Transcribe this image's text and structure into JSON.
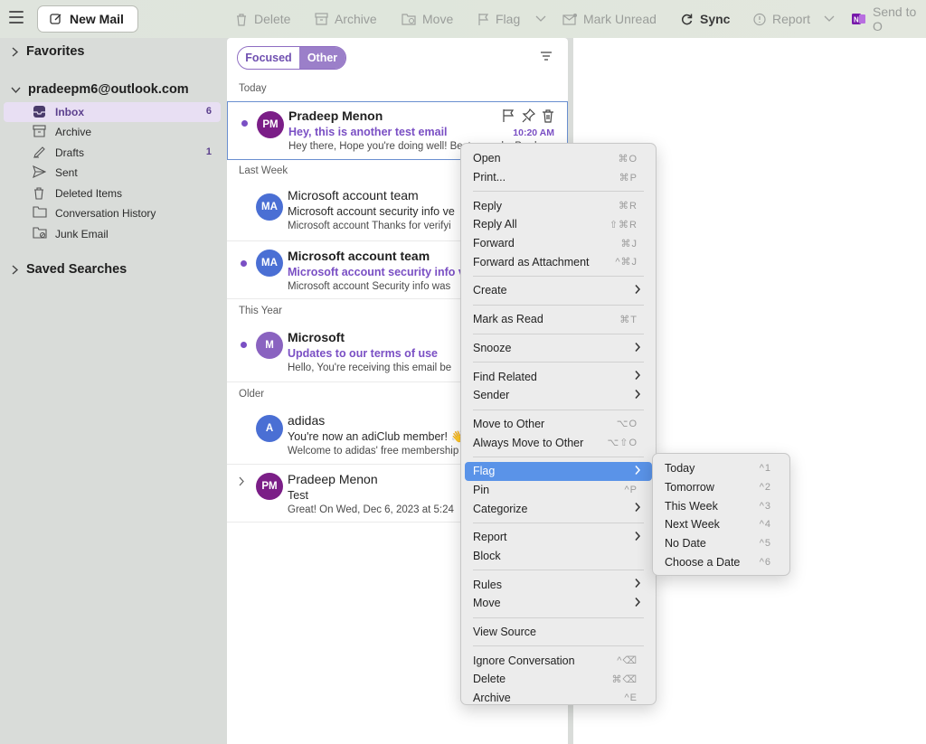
{
  "toolbar": {
    "new_mail": "New Mail",
    "delete": "Delete",
    "archive": "Archive",
    "move": "Move",
    "flag": "Flag",
    "mark_unread": "Mark Unread",
    "sync": "Sync",
    "report": "Report",
    "send_to": "Send to O"
  },
  "sidebar": {
    "favorites": "Favorites",
    "account": "pradeepm6@outlook.com",
    "folders": [
      {
        "label": "Inbox",
        "count": "6",
        "icon": "inbox-icon"
      },
      {
        "label": "Archive",
        "count": "",
        "icon": "archive-icon"
      },
      {
        "label": "Drafts",
        "count": "1",
        "icon": "pencil-icon"
      },
      {
        "label": "Sent",
        "count": "",
        "icon": "send-icon"
      },
      {
        "label": "Deleted Items",
        "count": "",
        "icon": "trash-icon"
      },
      {
        "label": "Conversation History",
        "count": "",
        "icon": "folder-icon"
      },
      {
        "label": "Junk Email",
        "count": "",
        "icon": "junk-icon"
      }
    ],
    "saved_searches": "Saved Searches"
  },
  "list": {
    "tab_focused": "Focused",
    "tab_other": "Other",
    "groups": [
      "Today",
      "Last Week",
      "This Year",
      "Older"
    ],
    "messages": [
      {
        "initials": "PM",
        "avatar_color": "#7b1e87",
        "sender": "Pradeep Menon",
        "subject": "Hey, this is another test email",
        "preview": "Hey there, Hope you're doing well! Best regards, Prad",
        "time": "10:20 AM",
        "unread": true
      },
      {
        "initials": "MA",
        "avatar_color": "#4a6fd4",
        "sender": "Microsoft account team",
        "subject": "Microsoft account security info ve",
        "preview": "Microsoft account Thanks for verifyi",
        "time": "",
        "unread": false
      },
      {
        "initials": "MA",
        "avatar_color": "#4a6fd4",
        "sender": "Microsoft account team",
        "subject": "Microsoft account security info v",
        "preview": "Microsoft account Security info was",
        "time": "",
        "unread": true
      },
      {
        "initials": "M",
        "avatar_color": "#8a63c0",
        "sender": "Microsoft",
        "subject": "Updates to our terms of use",
        "preview": "Hello, You're receiving this email be",
        "time": "",
        "unread": true
      },
      {
        "initials": "A",
        "avatar_color": "#4a6fd4",
        "sender": "adidas",
        "subject": "You're now an adiClub member! 👋",
        "preview": "Welcome to adidas' free membership",
        "time": "",
        "unread": false
      },
      {
        "initials": "PM",
        "avatar_color": "#7b1e87",
        "sender": "Pradeep Menon",
        "subject": "Test",
        "preview": "Great! On Wed, Dec 6, 2023 at 5:24",
        "time": "",
        "unread": false
      }
    ]
  },
  "context_menu": {
    "items": [
      {
        "label": "Open",
        "shortcut": "⌘O"
      },
      {
        "label": "Print...",
        "shortcut": "⌘P"
      },
      {
        "sep": true
      },
      {
        "label": "Reply",
        "shortcut": "⌘R"
      },
      {
        "label": "Reply All",
        "shortcut": "⇧⌘R"
      },
      {
        "label": "Forward",
        "shortcut": "⌘J"
      },
      {
        "label": "Forward as Attachment",
        "shortcut": "^⌘J"
      },
      {
        "sep": true
      },
      {
        "label": "Create",
        "submenu": true
      },
      {
        "sep": true
      },
      {
        "label": "Mark as Read",
        "shortcut": "⌘T"
      },
      {
        "sep": true
      },
      {
        "label": "Snooze",
        "submenu": true
      },
      {
        "sep": true
      },
      {
        "label": "Find Related",
        "submenu": true
      },
      {
        "label": "Sender",
        "submenu": true
      },
      {
        "sep": true
      },
      {
        "label": "Move to Other",
        "shortcut": "⌥O"
      },
      {
        "label": "Always Move to Other",
        "shortcut": "⌥⇧O"
      },
      {
        "sep": true
      },
      {
        "label": "Flag",
        "submenu": true,
        "highlighted": true
      },
      {
        "label": "Pin",
        "shortcut": "^P"
      },
      {
        "label": "Categorize",
        "submenu": true
      },
      {
        "sep": true
      },
      {
        "label": "Report",
        "submenu": true
      },
      {
        "label": "Block"
      },
      {
        "sep": true
      },
      {
        "label": "Rules",
        "submenu": true
      },
      {
        "label": "Move",
        "submenu": true
      },
      {
        "sep": true
      },
      {
        "label": "View Source"
      },
      {
        "sep": true
      },
      {
        "label": "Ignore Conversation",
        "shortcut": "^⌫"
      },
      {
        "label": "Delete",
        "shortcut": "⌘⌫"
      },
      {
        "label": "Archive",
        "shortcut": "^E"
      }
    ]
  },
  "flag_submenu": {
    "items": [
      {
        "label": "Today",
        "shortcut": "^1"
      },
      {
        "label": "Tomorrow",
        "shortcut": "^2"
      },
      {
        "label": "This Week",
        "shortcut": "^3"
      },
      {
        "label": "Next Week",
        "shortcut": "^4"
      },
      {
        "label": "No Date",
        "shortcut": "^5"
      },
      {
        "label": "Choose a Date",
        "shortcut": "^6"
      }
    ]
  }
}
